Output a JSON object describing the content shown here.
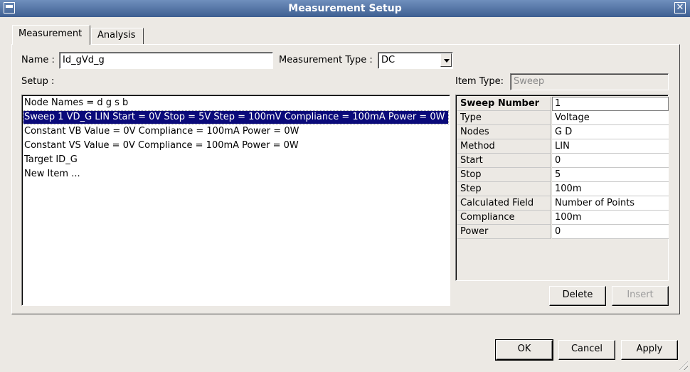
{
  "window": {
    "title": "Measurement Setup"
  },
  "tabs": [
    {
      "label": "Measurement",
      "mnemonic": "M"
    },
    {
      "label": "Analysis",
      "mnemonic": "l"
    }
  ],
  "name_field": {
    "label": "Name :",
    "value": "Id_gVd_g"
  },
  "measurement_type": {
    "label": "Measurement Type :",
    "value": "DC"
  },
  "setup": {
    "label": "Setup :",
    "items": [
      "Node Names = d g s b",
      "Sweep 1 VD_G LIN Start = 0V Stop = 5V Step = 100mV Compliance = 100mA Power = 0W",
      "Constant VB Value = 0V Compliance = 100mA Power = 0W",
      "Constant VS Value = 0V Compliance = 100mA Power = 0W",
      "Target ID_G",
      "New Item ..."
    ]
  },
  "item_type": {
    "label": "Item Type:",
    "value": "Sweep"
  },
  "properties": [
    {
      "key": "Sweep Number",
      "value": "1"
    },
    {
      "key": "Type",
      "value": "Voltage"
    },
    {
      "key": "Nodes",
      "value": "G D"
    },
    {
      "key": "Method",
      "value": "LIN"
    },
    {
      "key": "Start",
      "value": "0"
    },
    {
      "key": "Stop",
      "value": "5"
    },
    {
      "key": "Step",
      "value": "100m"
    },
    {
      "key": "Calculated Field",
      "value": "Number of Points"
    },
    {
      "key": "Compliance",
      "value": "100m"
    },
    {
      "key": "Power",
      "value": "0"
    }
  ],
  "buttons": {
    "delete": "Delete",
    "insert": "Insert",
    "ok": "OK",
    "cancel": "Cancel",
    "apply": "Apply"
  }
}
